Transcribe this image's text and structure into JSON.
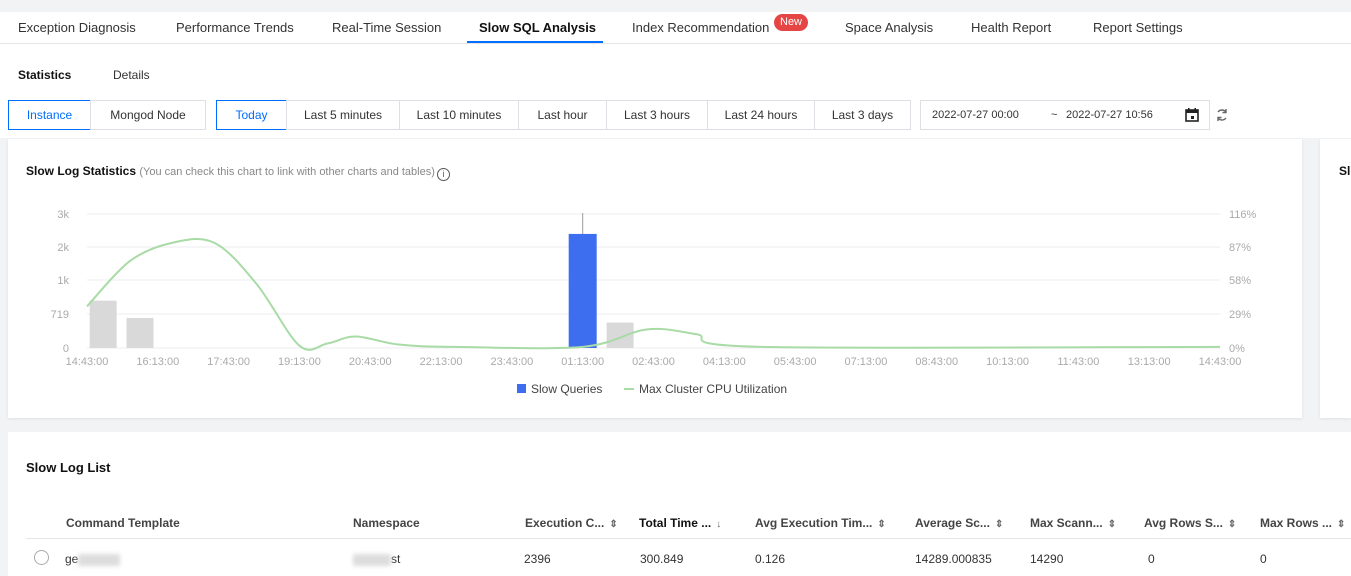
{
  "top_tabs": [
    {
      "label": "Exception Diagnosis"
    },
    {
      "label": "Performance Trends"
    },
    {
      "label": "Real-Time Session"
    },
    {
      "label": "Slow SQL Analysis",
      "active": true
    },
    {
      "label": "Index Recommendation",
      "badge": "New"
    },
    {
      "label": "Space Analysis"
    },
    {
      "label": "Health Report"
    },
    {
      "label": "Report Settings"
    }
  ],
  "sub_tabs": [
    {
      "label": "Statistics",
      "active": true
    },
    {
      "label": "Details"
    }
  ],
  "scope_buttons": [
    {
      "label": "Instance",
      "selected": true
    },
    {
      "label": "Mongod Node"
    }
  ],
  "time_buttons": [
    {
      "label": "Today",
      "selected": true
    },
    {
      "label": "Last 5 minutes"
    },
    {
      "label": "Last 10 minutes"
    },
    {
      "label": "Last hour"
    },
    {
      "label": "Last 3 hours"
    },
    {
      "label": "Last 24 hours"
    },
    {
      "label": "Last 3 days"
    }
  ],
  "date_range": {
    "start": "2022-07-27 00:00",
    "separator": "~",
    "end": "2022-07-27 10:56"
  },
  "chart_card": {
    "title": "Slow Log Statistics",
    "note": "(You can check this chart to link with other charts and tables)",
    "side_card_title": "Sl"
  },
  "chart_data": {
    "type": "bar",
    "categories": [
      "14:43:00",
      "16:13:00",
      "17:43:00",
      "19:13:00",
      "20:43:00",
      "22:13:00",
      "23:43:00",
      "01:13:00",
      "02:43:00",
      "04:13:00",
      "05:43:00",
      "07:13:00",
      "08:43:00",
      "10:13:00",
      "11:43:00",
      "13:13:00",
      "14:43:00"
    ],
    "y_left_ticks": [
      "0",
      "719",
      "1k",
      "2k",
      "3k"
    ],
    "y_right_ticks": [
      "0%",
      "29%",
      "58%",
      "87%",
      "116%"
    ],
    "series": [
      {
        "name": "Slow Queries",
        "color": "#3d6ef0",
        "bars": [
          {
            "x": 7.0,
            "value": 2396,
            "highlight": true
          }
        ]
      },
      {
        "name": "Max Cluster CPU Utilization",
        "color": "#a8dba5",
        "points": [
          [
            0,
            36
          ],
          [
            0.6,
            75
          ],
          [
            1.2,
            91
          ],
          [
            1.8,
            91
          ],
          [
            2.4,
            55
          ],
          [
            3.0,
            2
          ],
          [
            3.4,
            4
          ],
          [
            3.8,
            10
          ],
          [
            4.4,
            3
          ],
          [
            5.2,
            1
          ],
          [
            7.0,
            1
          ],
          [
            7.9,
            16
          ],
          [
            8.6,
            12
          ],
          [
            9.5,
            1
          ],
          [
            16,
            1
          ]
        ]
      }
    ],
    "background_bars": [
      {
        "x": 0.2,
        "value": 41
      },
      {
        "x": 0.72,
        "value": 26
      },
      {
        "x": 7.5,
        "value": 22
      }
    ],
    "legend": [
      "Slow Queries",
      "Max Cluster CPU Utilization"
    ]
  },
  "list": {
    "title": "Slow Log List",
    "columns": [
      {
        "label": "Command Template"
      },
      {
        "label": "Namespace"
      },
      {
        "label": "Execution C...",
        "sort": "⇕"
      },
      {
        "label": "Total Time ...",
        "sort": "↓",
        "sorted": true
      },
      {
        "label": "Avg Execution Tim...",
        "sort": "⇕"
      },
      {
        "label": "Average Sc...",
        "sort": "⇕"
      },
      {
        "label": "Max Scann...",
        "sort": "⇕"
      },
      {
        "label": "Avg Rows S...",
        "sort": "⇕"
      },
      {
        "label": "Max Rows ...",
        "sort": "⇕"
      }
    ],
    "rows": [
      {
        "template": "ge",
        "namespace": "st",
        "exec_count": "2396",
        "total_time": "300.849",
        "avg_time": "0.126",
        "avg_scan": "14289.000835",
        "max_scan": "14290",
        "avg_rows": "0",
        "max_rows": "0"
      }
    ]
  }
}
